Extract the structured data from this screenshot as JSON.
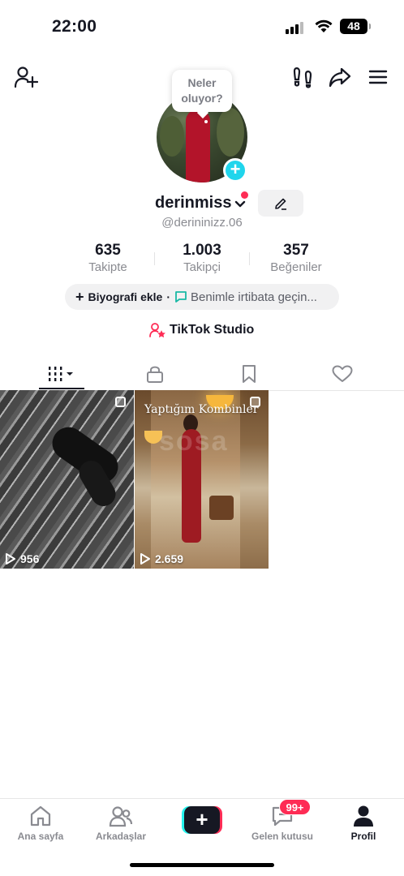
{
  "status_bar": {
    "time": "22:00",
    "battery": "48"
  },
  "bubble": {
    "line1": "Neler",
    "line2": "oluyor?"
  },
  "profile": {
    "username": "derinmiss",
    "handle": "@derininizz.06",
    "stats": [
      {
        "value": "635",
        "label": "Takipte"
      },
      {
        "value": "1.003",
        "label": "Takipçi"
      },
      {
        "value": "357",
        "label": "Beğeniler"
      }
    ],
    "bio_add": "Biyografi ekle",
    "bio_separator": "·",
    "contact": "Benimle irtibata geçin...",
    "studio": "TikTok Studio"
  },
  "videos": [
    {
      "views": "956"
    },
    {
      "views": "2.659",
      "caption": "Yaptığım Kombinler",
      "watermark": "sosa"
    }
  ],
  "nav": {
    "home": "Ana sayfa",
    "friends": "Arkadaşlar",
    "inbox": "Gelen kutusu",
    "inbox_badge": "99+",
    "profile": "Profil"
  },
  "colors": {
    "accent_red": "#fe2c55",
    "accent_cyan": "#20d5ec",
    "text": "#161823",
    "muted": "#8a8b91"
  },
  "icons": [
    "add-friend-icon",
    "footprints-icon",
    "share-icon",
    "menu-icon",
    "plus-icon",
    "chevron-down-icon",
    "pencil-icon",
    "chat-bubble-icon",
    "studio-icon",
    "grid-icon",
    "lock-icon",
    "bookmark-icon",
    "heart-icon",
    "play-icon",
    "home-icon",
    "friends-icon",
    "create-icon",
    "inbox-icon",
    "profile-icon"
  ]
}
